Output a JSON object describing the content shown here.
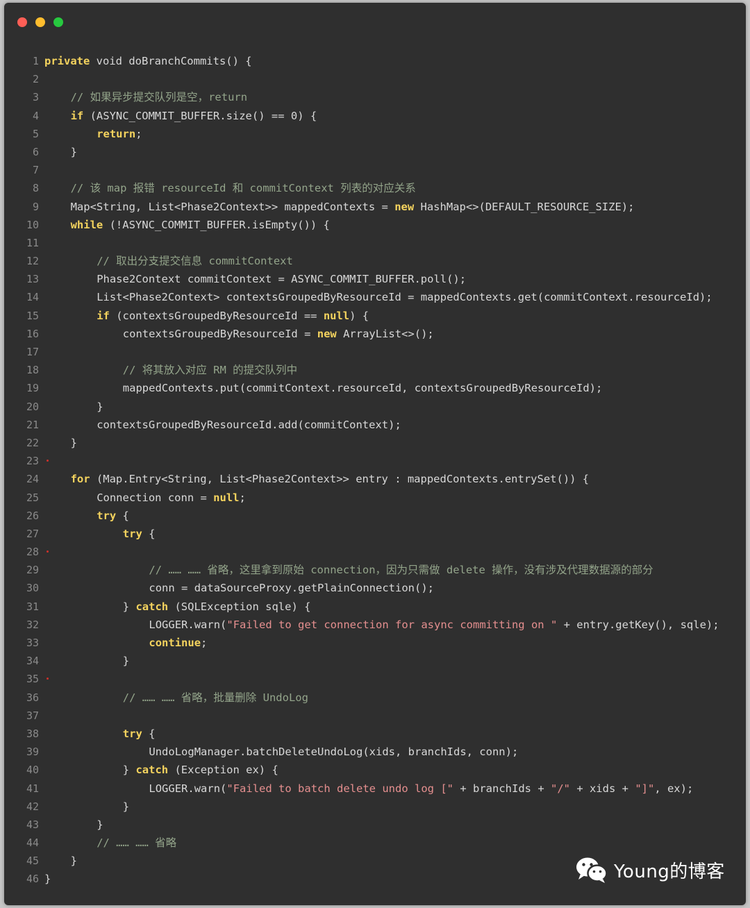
{
  "window": {
    "traffic_lights": [
      "close",
      "minimize",
      "zoom"
    ],
    "colors": {
      "red": "#ff5f56",
      "yellow": "#ffbd2e",
      "green": "#27c93f",
      "background": "#2f2f2f",
      "keyword": "#f4d35e",
      "comment": "#93a48a",
      "string": "#e58f8f"
    }
  },
  "code": {
    "lines": [
      {
        "n": "1",
        "indent": 0,
        "tokens": [
          {
            "t": "k",
            "v": "private"
          },
          {
            "t": "p",
            "v": " void doBranchCommits() {"
          }
        ]
      },
      {
        "n": "2",
        "indent": 0,
        "tokens": []
      },
      {
        "n": "3",
        "indent": 1,
        "tokens": [
          {
            "t": "c",
            "v": "// 如果异步提交队列是空，return"
          }
        ]
      },
      {
        "n": "4",
        "indent": 1,
        "tokens": [
          {
            "t": "k",
            "v": "if"
          },
          {
            "t": "p",
            "v": " (ASYNC_COMMIT_BUFFER.size() == 0) {"
          }
        ]
      },
      {
        "n": "5",
        "indent": 2,
        "tokens": [
          {
            "t": "k",
            "v": "return"
          },
          {
            "t": "p",
            "v": ";"
          }
        ]
      },
      {
        "n": "6",
        "indent": 1,
        "tokens": [
          {
            "t": "p",
            "v": "}"
          }
        ]
      },
      {
        "n": "7",
        "indent": 0,
        "tokens": []
      },
      {
        "n": "8",
        "indent": 1,
        "tokens": [
          {
            "t": "c",
            "v": "// 该 map 报错 resourceId 和 commitContext 列表的对应关系"
          }
        ]
      },
      {
        "n": "9",
        "indent": 1,
        "tokens": [
          {
            "t": "p",
            "v": "Map<String, List<Phase2Context>> mappedContexts = "
          },
          {
            "t": "k",
            "v": "new"
          },
          {
            "t": "p",
            "v": " HashMap<>(DEFAULT_RESOURCE_SIZE);"
          }
        ]
      },
      {
        "n": "10",
        "indent": 1,
        "tokens": [
          {
            "t": "k",
            "v": "while"
          },
          {
            "t": "p",
            "v": " (!ASYNC_COMMIT_BUFFER.isEmpty()) {"
          }
        ]
      },
      {
        "n": "11",
        "indent": 0,
        "tokens": []
      },
      {
        "n": "12",
        "indent": 2,
        "tokens": [
          {
            "t": "c",
            "v": "// 取出分支提交信息 commitContext"
          }
        ]
      },
      {
        "n": "13",
        "indent": 2,
        "tokens": [
          {
            "t": "p",
            "v": "Phase2Context commitContext = ASYNC_COMMIT_BUFFER.poll();"
          }
        ]
      },
      {
        "n": "14",
        "indent": 2,
        "tokens": [
          {
            "t": "p",
            "v": "List<Phase2Context> contextsGroupedByResourceId = mappedContexts.get(commitContext.resourceId);"
          }
        ]
      },
      {
        "n": "15",
        "indent": 2,
        "tokens": [
          {
            "t": "k",
            "v": "if"
          },
          {
            "t": "p",
            "v": " (contextsGroupedByResourceId == "
          },
          {
            "t": "k",
            "v": "null"
          },
          {
            "t": "p",
            "v": ") {"
          }
        ]
      },
      {
        "n": "16",
        "indent": 3,
        "tokens": [
          {
            "t": "p",
            "v": "contextsGroupedByResourceId = "
          },
          {
            "t": "k",
            "v": "new"
          },
          {
            "t": "p",
            "v": " ArrayList<>();"
          }
        ]
      },
      {
        "n": "17",
        "indent": 0,
        "tokens": []
      },
      {
        "n": "18",
        "indent": 3,
        "tokens": [
          {
            "t": "c",
            "v": "// 将其放入对应 RM 的提交队列中"
          }
        ]
      },
      {
        "n": "19",
        "indent": 3,
        "tokens": [
          {
            "t": "p",
            "v": "mappedContexts.put(commitContext.resourceId, contextsGroupedByResourceId);"
          }
        ]
      },
      {
        "n": "20",
        "indent": 2,
        "tokens": [
          {
            "t": "p",
            "v": "}"
          }
        ]
      },
      {
        "n": "21",
        "indent": 2,
        "tokens": [
          {
            "t": "p",
            "v": "contextsGroupedByResourceId.add(commitContext);"
          }
        ]
      },
      {
        "n": "22",
        "indent": 1,
        "tokens": [
          {
            "t": "p",
            "v": "}"
          }
        ]
      },
      {
        "n": "23",
        "indent": 0,
        "marker": true,
        "tokens": []
      },
      {
        "n": "24",
        "indent": 1,
        "tokens": [
          {
            "t": "k",
            "v": "for"
          },
          {
            "t": "p",
            "v": " (Map.Entry<String, List<Phase2Context>> entry : mappedContexts.entrySet()) {"
          }
        ]
      },
      {
        "n": "25",
        "indent": 2,
        "tokens": [
          {
            "t": "p",
            "v": "Connection conn = "
          },
          {
            "t": "k",
            "v": "null"
          },
          {
            "t": "p",
            "v": ";"
          }
        ]
      },
      {
        "n": "26",
        "indent": 2,
        "tokens": [
          {
            "t": "k",
            "v": "try"
          },
          {
            "t": "p",
            "v": " {"
          }
        ]
      },
      {
        "n": "27",
        "indent": 3,
        "tokens": [
          {
            "t": "k",
            "v": "try"
          },
          {
            "t": "p",
            "v": " {"
          }
        ]
      },
      {
        "n": "28",
        "indent": 0,
        "marker": true,
        "tokens": []
      },
      {
        "n": "29",
        "indent": 4,
        "tokens": [
          {
            "t": "c",
            "v": "// …… …… 省略，这里拿到原始 connection，因为只需做 delete 操作，没有涉及代理数据源的部分"
          }
        ]
      },
      {
        "n": "30",
        "indent": 4,
        "tokens": [
          {
            "t": "p",
            "v": "conn = dataSourceProxy.getPlainConnection();"
          }
        ]
      },
      {
        "n": "31",
        "indent": 3,
        "tokens": [
          {
            "t": "p",
            "v": "} "
          },
          {
            "t": "k",
            "v": "catch"
          },
          {
            "t": "p",
            "v": " (SQLException sqle) {"
          }
        ]
      },
      {
        "n": "32",
        "indent": 4,
        "tokens": [
          {
            "t": "p",
            "v": "LOGGER.warn("
          },
          {
            "t": "s",
            "v": "\"Failed to get connection for async committing on \""
          },
          {
            "t": "p",
            "v": " + entry.getKey(), sqle);"
          }
        ]
      },
      {
        "n": "33",
        "indent": 4,
        "tokens": [
          {
            "t": "k",
            "v": "continue"
          },
          {
            "t": "p",
            "v": ";"
          }
        ]
      },
      {
        "n": "34",
        "indent": 3,
        "tokens": [
          {
            "t": "p",
            "v": "}"
          }
        ]
      },
      {
        "n": "35",
        "indent": 0,
        "marker": true,
        "tokens": []
      },
      {
        "n": "36",
        "indent": 3,
        "tokens": [
          {
            "t": "c",
            "v": "// …… …… 省略，批量删除 UndoLog"
          }
        ]
      },
      {
        "n": "37",
        "indent": 0,
        "tokens": []
      },
      {
        "n": "38",
        "indent": 3,
        "tokens": [
          {
            "t": "k",
            "v": "try"
          },
          {
            "t": "p",
            "v": " {"
          }
        ]
      },
      {
        "n": "39",
        "indent": 4,
        "tokens": [
          {
            "t": "p",
            "v": "UndoLogManager.batchDeleteUndoLog(xids, branchIds, conn);"
          }
        ]
      },
      {
        "n": "40",
        "indent": 3,
        "tokens": [
          {
            "t": "p",
            "v": "} "
          },
          {
            "t": "k",
            "v": "catch"
          },
          {
            "t": "p",
            "v": " (Exception ex) {"
          }
        ]
      },
      {
        "n": "41",
        "indent": 4,
        "tokens": [
          {
            "t": "p",
            "v": "LOGGER.warn("
          },
          {
            "t": "s",
            "v": "\"Failed to batch delete undo log [\""
          },
          {
            "t": "p",
            "v": " + branchIds + "
          },
          {
            "t": "s",
            "v": "\"/\""
          },
          {
            "t": "p",
            "v": " + xids + "
          },
          {
            "t": "s",
            "v": "\"]\""
          },
          {
            "t": "p",
            "v": ", ex);"
          }
        ]
      },
      {
        "n": "42",
        "indent": 3,
        "tokens": [
          {
            "t": "p",
            "v": "}"
          }
        ]
      },
      {
        "n": "43",
        "indent": 2,
        "tokens": [
          {
            "t": "p",
            "v": "}"
          }
        ]
      },
      {
        "n": "44",
        "indent": 2,
        "tokens": [
          {
            "t": "c",
            "v": "// …… …… 省略"
          }
        ]
      },
      {
        "n": "45",
        "indent": 1,
        "tokens": [
          {
            "t": "p",
            "v": "}"
          }
        ]
      },
      {
        "n": "46",
        "indent": 0,
        "tokens": [
          {
            "t": "p",
            "v": "}"
          }
        ]
      }
    ]
  },
  "watermark": {
    "icon": "wechat-icon",
    "text": "Young的博客"
  }
}
